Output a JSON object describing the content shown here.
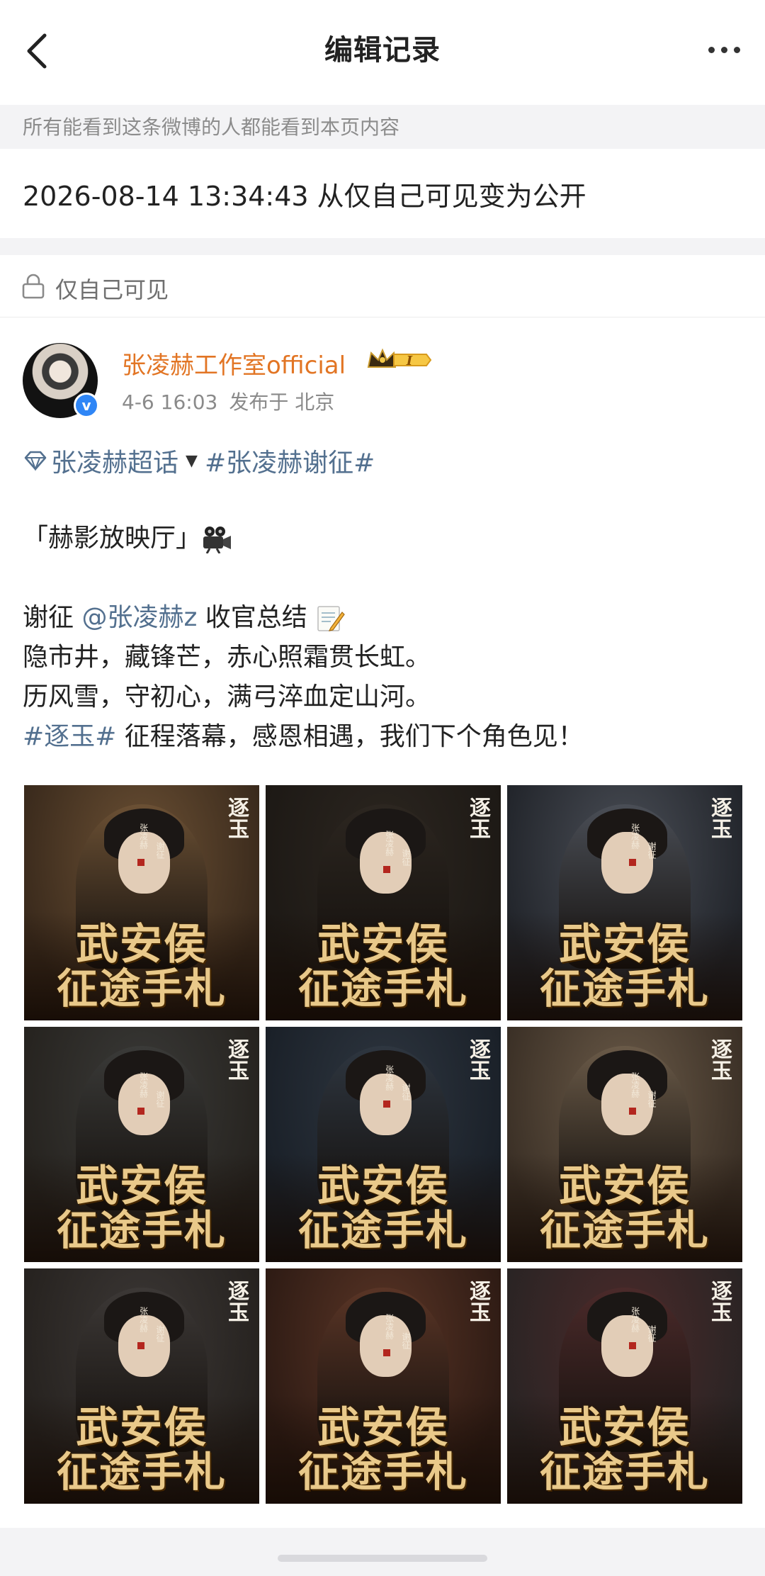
{
  "nav": {
    "title": "编辑记录",
    "back_icon": "chevron-left-icon",
    "more_icon": "more-dots-icon"
  },
  "notice": "所有能看到这条微博的人都能看到本页内容",
  "change_record": "2026-08-14 13:34:43 从仅自己可见变为公开",
  "post": {
    "privacy_label": "仅自己可见",
    "author": "张凌赫工作室official",
    "member_badge": "I",
    "time": "4-6 16:03",
    "location": "发布于 北京",
    "super_topic": "张凌赫超话",
    "hashtag": "#张凌赫谢征#",
    "line_cinema": "「赫影放映厅」",
    "line_mention_prefix": "谢征 ",
    "mention": "@张凌赫z",
    "line_mention_suffix": " 收官总结",
    "line_poem1": "隐市井，藏锋芒，赤心照霜贯长虹。",
    "line_poem2": "历风雪，守初心，满弓淬血定山河。",
    "hashtag2": "#逐玉#",
    "line_end": " 征程落幕，感恩相遇，我们下个角色见！"
  },
  "images": [
    {
      "title1": "武安侯",
      "title2": "征途手札",
      "logo": "逐玉",
      "cast": "张凌赫",
      "role": "谢征",
      "tone": "#6b5034",
      "bg": "#3a2a1c"
    },
    {
      "title1": "武安侯",
      "title2": "征途手札",
      "logo": "逐玉",
      "cast": "张凌赫",
      "role": "谢征",
      "tone": "#2c2620",
      "bg": "#1d1915"
    },
    {
      "title1": "武安侯",
      "title2": "征途手札",
      "logo": "逐玉",
      "cast": "张凌赫",
      "role": "谢征",
      "tone": "#4a4e56",
      "bg": "#22252b"
    },
    {
      "title1": "武安侯",
      "title2": "征途手札",
      "logo": "逐玉",
      "cast": "张凌赫",
      "role": "谢征",
      "tone": "#3a3a38",
      "bg": "#26231f"
    },
    {
      "title1": "武安侯",
      "title2": "征途手札",
      "logo": "逐玉",
      "cast": "张凌赫",
      "role": "谢征",
      "tone": "#2e3640",
      "bg": "#1a2028"
    },
    {
      "title1": "武安侯",
      "title2": "征途手札",
      "logo": "逐玉",
      "cast": "张凌赫",
      "role": "谢征",
      "tone": "#6a5a48",
      "bg": "#3b3026"
    },
    {
      "title1": "武安侯",
      "title2": "征途手札",
      "logo": "逐玉",
      "cast": "张凌赫",
      "role": "谢征",
      "tone": "#3c3836",
      "bg": "#26221f"
    },
    {
      "title1": "武安侯",
      "title2": "征途手札",
      "logo": "逐玉",
      "cast": "张凌赫",
      "role": "谢征",
      "tone": "#5a3526",
      "bg": "#2e1b14"
    },
    {
      "title1": "武安侯",
      "title2": "征途手札",
      "logo": "逐玉",
      "cast": "张凌赫",
      "role": "谢征",
      "tone": "#4b2a2a",
      "bg": "#2a2424"
    }
  ],
  "colors": {
    "accent_orange": "#e27524",
    "link_blue": "#53708f",
    "verified_blue": "#2f86f6",
    "gold": "#e9c98a"
  }
}
